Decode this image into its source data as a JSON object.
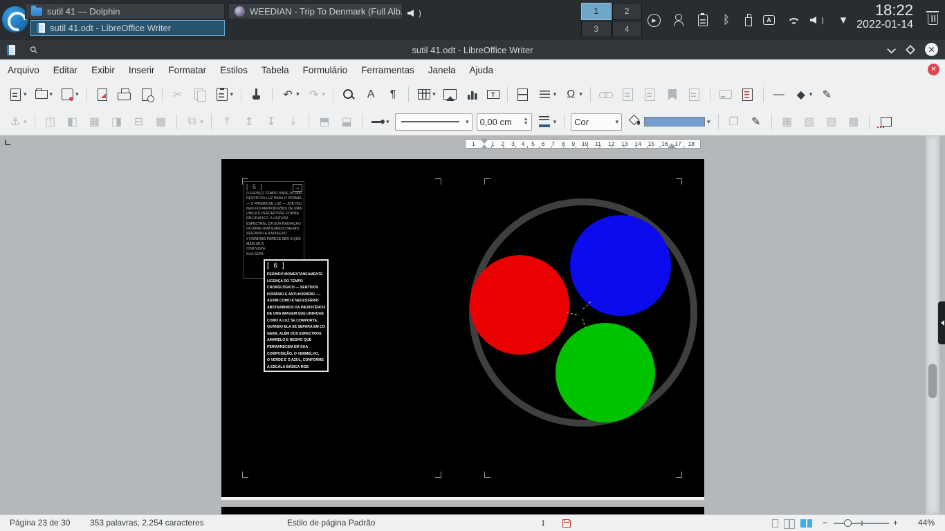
{
  "colors": {
    "accent": "#3daee9",
    "swatch": "#729fcf",
    "save_red": "#da4453",
    "red": "#e90000",
    "green": "#00c300",
    "blue": "#0b0bee",
    "ring": "#3f3f3f",
    "dash": "#d0c24e"
  },
  "taskbar": {
    "tasks": {
      "dolphin": "sutil 41 — Dolphin",
      "writer": "sutil 41.odt - LibreOffice Writer",
      "weedian": "WEEDIAN - Trip To Denmark (Full Alb..."
    },
    "pager": [
      {
        "label": "1",
        "active": true,
        "name": "virtual-desktop-1"
      },
      {
        "label": "2",
        "name": "virtual-desktop-2"
      },
      {
        "label": "3",
        "name": "virtual-desktop-3"
      },
      {
        "label": "4",
        "name": "virtual-desktop-4"
      }
    ],
    "tray": [
      {
        "name": "media-player-icon",
        "ic": "ring",
        "g": "▶"
      },
      {
        "name": "user-switch-icon",
        "ic": "user"
      },
      {
        "name": "clipboard-icon",
        "ic": "clipboard2"
      },
      {
        "name": "bluetooth-icon",
        "g": "ᛒ"
      },
      {
        "name": "removable-device-icon",
        "ic": "usb"
      },
      {
        "name": "keyboard-layout-icon",
        "ic": "kbd",
        "g": "A"
      },
      {
        "name": "network-wifi-icon",
        "ic": "wifi"
      },
      {
        "name": "volume-icon",
        "ic": "speaker"
      },
      {
        "name": "tray-expand-icon",
        "g": "▾"
      }
    ],
    "clock": {
      "time": "18:22",
      "date": "2022-01-14"
    }
  },
  "window": {
    "title": "sutil 41.odt - LibreOffice Writer",
    "menu": [
      {
        "label": "Arquivo",
        "name": "menu-arquivo"
      },
      {
        "label": "Editar",
        "name": "menu-editar"
      },
      {
        "label": "Exibir",
        "name": "menu-exibir"
      },
      {
        "label": "Inserir",
        "name": "menu-inserir"
      },
      {
        "label": "Formatar",
        "name": "menu-formatar"
      },
      {
        "label": "Estilos",
        "name": "menu-estilos"
      },
      {
        "label": "Tabela",
        "name": "menu-tabela"
      },
      {
        "label": "Formulário",
        "name": "menu-formulario"
      },
      {
        "label": "Ferramentas",
        "name": "menu-ferramentas"
      },
      {
        "label": "Janela",
        "name": "menu-janela"
      },
      {
        "label": "Ajuda",
        "name": "menu-ajuda"
      }
    ],
    "toolbar_main": [
      {
        "name": "new-document-button",
        "ic": "newdoc",
        "dd": 1
      },
      {
        "name": "open-button",
        "ic": "folder",
        "dd": 1
      },
      {
        "name": "save-button",
        "ic": "floppy",
        "dd": 1
      },
      {
        "sep": 1
      },
      {
        "name": "export-pdf-button",
        "ic": "pdf"
      },
      {
        "name": "print-button",
        "ic": "printer"
      },
      {
        "name": "print-preview-button",
        "ic": "preview"
      },
      {
        "sep": 1
      },
      {
        "name": "cut-button",
        "g": "✂",
        "dis": 1
      },
      {
        "name": "copy-button",
        "ic": "copy",
        "dis": 1
      },
      {
        "name": "paste-button",
        "ic": "clipboard",
        "dd": 1
      },
      {
        "sep": 1
      },
      {
        "name": "clone-formatting-button",
        "ic": "brush"
      },
      {
        "sep": 1
      },
      {
        "name": "undo-button",
        "g": "↶",
        "dd": 1
      },
      {
        "name": "redo-button",
        "g": "↷",
        "dd": 1,
        "dis": 1
      },
      {
        "sep": 1
      },
      {
        "name": "find-replace-button",
        "ic": "magnifier"
      },
      {
        "name": "character-dialog-button",
        "g": "A"
      },
      {
        "name": "formatting-marks-button",
        "g": "¶"
      },
      {
        "sep": 1
      },
      {
        "name": "insert-table-button",
        "ic": "table",
        "dd": 1
      },
      {
        "name": "insert-image-button",
        "ic": "image"
      },
      {
        "name": "insert-chart-button",
        "ic": "chart"
      },
      {
        "name": "insert-textbox-button",
        "ic": "textbox",
        "g": "T"
      },
      {
        "sep": 1
      },
      {
        "name": "insert-page-break-button",
        "ic": "pagebreak"
      },
      {
        "name": "insert-field-button",
        "ic": "field",
        "dd": 1
      },
      {
        "name": "insert-special-character-button",
        "g": "Ω",
        "dd": 1
      },
      {
        "sep": 1
      },
      {
        "name": "insert-hyperlink-button",
        "ic": "link",
        "dis": 1
      },
      {
        "name": "insert-footnote-button",
        "ic": "doclines",
        "dis": 1
      },
      {
        "name": "insert-endnote-button",
        "ic": "doclines",
        "dis": 1
      },
      {
        "name": "insert-bookmark-button",
        "ic": "bookmark",
        "dis": 1
      },
      {
        "name": "insert-cross-reference-button",
        "ic": "doclines",
        "dis": 1
      },
      {
        "sep": 1
      },
      {
        "name": "insert-comment-button",
        "ic": "comment",
        "dis": 1
      },
      {
        "name": "track-changes-button",
        "ic": "trackdoc"
      },
      {
        "sep": 1
      },
      {
        "name": "horizontal-line-button",
        "g": "—"
      },
      {
        "name": "basic-shapes-button",
        "g": "◆",
        "dd": 1
      },
      {
        "name": "freeform-line-button",
        "g": "✎"
      }
    ],
    "toolbar_frame_left": [
      {
        "name": "anchor-button",
        "g": "⚓",
        "dd": 1,
        "dis": 1
      },
      {
        "sep": 1
      },
      {
        "name": "wrap-off-button",
        "g": "◫",
        "dis": 1
      },
      {
        "name": "wrap-left-button",
        "g": "◧",
        "dis": 1
      },
      {
        "name": "wrap-through-button",
        "g": "▦",
        "dis": 1
      },
      {
        "name": "wrap-right-button",
        "g": "◨",
        "dis": 1
      },
      {
        "name": "wrap-parallel-button",
        "g": "⊟",
        "dis": 1
      },
      {
        "name": "wrap-optimal-button",
        "g": "▩",
        "dis": 1
      },
      {
        "sep": 1
      },
      {
        "name": "align-objects-button",
        "g": "⧉",
        "dd": 1,
        "dis": 1
      },
      {
        "sep": 1
      },
      {
        "name": "bring-to-front-button",
        "g": "⤒",
        "dis": 1
      },
      {
        "name": "forward-one-button",
        "g": "↥",
        "dis": 1
      },
      {
        "name": "back-one-button",
        "g": "↧",
        "dis": 1
      },
      {
        "name": "send-to-back-button",
        "g": "⤓",
        "dis": 1
      },
      {
        "sep": 1
      },
      {
        "name": "to-foreground-button",
        "g": "⬒",
        "dis": 1
      },
      {
        "name": "to-background-button",
        "g": "⬓",
        "dis": 1
      },
      {
        "sep": 1
      },
      {
        "name": "line-style-button",
        "ic": "linearrow",
        "dd": 1
      }
    ],
    "toolbar_frame_right": [
      {
        "sep": 1
      },
      {
        "name": "rotate-button",
        "g": "❐",
        "dis": 1
      },
      {
        "name": "edit-points-button",
        "g": "✎"
      },
      {
        "sep": 1
      },
      {
        "name": "group-button",
        "g": "▦",
        "dis": 1
      },
      {
        "name": "ungroup-button",
        "g": "▧",
        "dis": 1
      },
      {
        "name": "enter-group-button",
        "g": "▨",
        "dis": 1
      },
      {
        "name": "exit-group-button",
        "g": "▩",
        "dis": 1
      },
      {
        "sep": 1
      },
      {
        "name": "frame-properties-button",
        "ic": "frameprops"
      }
    ],
    "widgets": {
      "line_width_value": "0,00 cm",
      "fill_type_value": "Cor"
    },
    "ruler": {
      "pre": "1",
      "numbers": [
        "1",
        "2",
        "3",
        "4",
        "5",
        "6",
        "7",
        "8",
        "9",
        "10",
        "11",
        "12",
        "13",
        "14",
        "15",
        "16",
        "17",
        "18"
      ]
    }
  },
  "document": {
    "frame5": {
      "header": "[ 5 ]",
      "link_arrow": "→",
      "lines": [
        "O ESPAÇO TEMPO ONDE OCORRE O",
        "DESVIO DA LUZ PARA O VERMELHO",
        "— O PRISMA DE LUZ —, ATÉ HOJE",
        "NÃO FOI REPRODUZIDO DE UMA",
        "ÚNICA E PERCEPTÍVEL FORMA.",
        "EM GRÁFICO, A LEITURA",
        "ESPECTRAL DA SUA RADIAÇÃO QUE",
        "OCORRE NUM ESPAÇO NEGRO",
        "SEGUNDO A RADIAÇÃO",
        "# HAWKING PARECE SER A QUE",
        "MAIS SE A",
        "COM VISTA",
        "SUA SEPA"
      ]
    },
    "frame6": {
      "header": "[ 6 ]",
      "lines": [
        "PEDINDO MOMENTANEAMENTE",
        "LICENÇA DO TEMPO",
        "CRONOLÓGICO — SENTIDOS",
        "HORÁRIO E ANTI-HORÁRIO —,",
        "ASSIM COMO É NECESSÁRIO",
        "ABSTRAIRMOS DA INEXISTÊNCIA",
        "DE UMA IMAGEM QUE UNIFIQUE",
        "COMO A LUZ SE COMPORTA,",
        "QUANDO ELA SE SEPARA EM CORES",
        "GERA, ALÉM DOS ESPECTROS",
        "AMARELO E NEGRO QUE",
        "PERMANECEM EM SUA",
        "COMPOSIÇÃO, O VERMELHO,",
        "O VERDE E O AZUL, CONFORME",
        "A ESCALA BÁSICA RGB"
      ]
    }
  },
  "statusbar": {
    "page_info": "Página 23 de 30",
    "word_count": "353 palavras, 2.254 caracteres",
    "page_style": "Estilo de página Padrão",
    "insert_indicator": "I",
    "zoom": "44%"
  }
}
